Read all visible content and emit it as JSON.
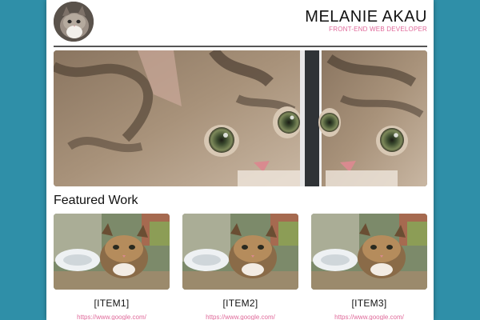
{
  "header": {
    "name": "MELANIE AKAU",
    "role": "FRONT-END WEB DEVELOPER"
  },
  "hero": {
    "image": "kitten-closeup-photo"
  },
  "featured": {
    "title": "Featured Work",
    "items": [
      {
        "title": "[ITEM1]",
        "link": "https://www.google.com/",
        "image": "kitten-photo"
      },
      {
        "title": "[ITEM2]",
        "link": "https://www.google.com/",
        "image": "kitten-photo"
      },
      {
        "title": "[ITEM3]",
        "link": "https://www.google.com/",
        "image": "kitten-photo"
      }
    ]
  },
  "colors": {
    "background": "#2f8fa8",
    "accent": "#e0699a",
    "text": "#111111"
  }
}
